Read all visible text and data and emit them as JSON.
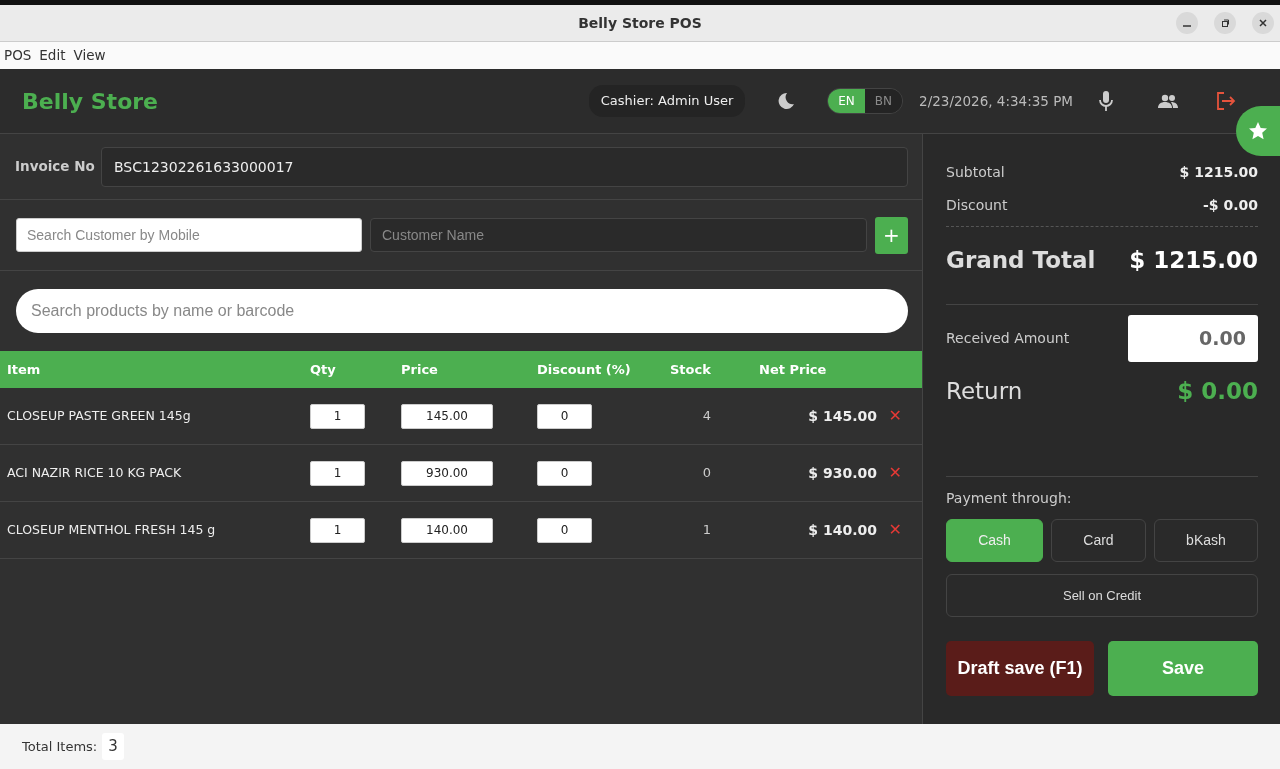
{
  "window": {
    "title": "Belly Store POS"
  },
  "menu": [
    "POS",
    "Edit",
    "View"
  ],
  "header": {
    "brand": "Belly Store",
    "cashier": "Cashier: Admin User",
    "languages": [
      {
        "label": "EN",
        "selected": true
      },
      {
        "label": "BN",
        "selected": false
      }
    ],
    "datetime": "2/23/2026, 4:34:35 PM"
  },
  "invoice": {
    "label": "Invoice No",
    "value": "BSC12302261633000017"
  },
  "customer": {
    "mobile_placeholder": "Search Customer by Mobile",
    "name_placeholder": "Customer Name",
    "add": "+"
  },
  "product_search": {
    "placeholder": "Search products by name or barcode"
  },
  "table": {
    "columns": [
      "Item",
      "Qty",
      "Price",
      "Discount (%)",
      "Stock",
      "Net Price"
    ],
    "rows": [
      {
        "item": "CLOSEUP PASTE GREEN 145g",
        "qty": "1",
        "price": "145.00",
        "discount": "0",
        "stock": "4",
        "net": "$ 145.00",
        "remove": "✕"
      },
      {
        "item": "ACI NAZIR RICE 10 KG PACK",
        "qty": "1",
        "price": "930.00",
        "discount": "0",
        "stock": "0",
        "net": "$ 930.00",
        "remove": "✕"
      },
      {
        "item": "CLOSEUP MENTHOL FRESH 145 g",
        "qty": "1",
        "price": "140.00",
        "discount": "0",
        "stock": "1",
        "net": "$ 140.00",
        "remove": "✕"
      }
    ]
  },
  "summary": {
    "subtotal_label": "Subtotal",
    "subtotal": "$ 1215.00",
    "discount_label": "Discount",
    "discount": "-$ 0.00",
    "grand_label": "Grand Total",
    "grand": "$ 1215.00",
    "received_label": "Received Amount",
    "received": "0.00",
    "return_label": "Return",
    "return": "$ 0.00"
  },
  "payment": {
    "label": "Payment through:",
    "methods": [
      {
        "label": "Cash",
        "selected": true
      },
      {
        "label": "Card",
        "selected": false
      },
      {
        "label": "bKash",
        "selected": false
      }
    ],
    "credit": "Sell on Credit"
  },
  "actions": {
    "draft": "Draft save (F1)",
    "save": "Save"
  },
  "footer": {
    "label": "Total Items:",
    "count": "3"
  }
}
